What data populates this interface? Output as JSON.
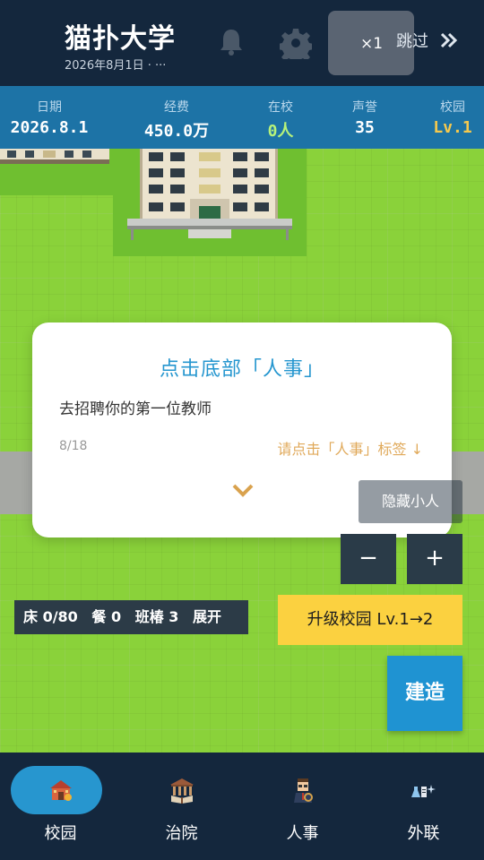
{
  "header": {
    "title": "猫扑大学",
    "subtitle": "2026年8月1日  ·  ···",
    "speed_label": "×1",
    "skip_label": "跳过"
  },
  "stats": [
    {
      "label": "日期",
      "value": "2026.8.1",
      "color": "#ffffff"
    },
    {
      "label": "经费",
      "value": "450.0万",
      "color": "#ffffff"
    },
    {
      "label": "在校",
      "value": "0人",
      "color": "#b7f27a"
    },
    {
      "label": "声誉",
      "value": "35",
      "color": "#ffffff"
    },
    {
      "label": "校园",
      "value": "Lv.1",
      "color": "#f6c94d"
    }
  ],
  "dialog": {
    "title": "点击底部「人事」",
    "text": "去招聘你的第一位教师",
    "progress": "8/18",
    "hint": "请点击「人事」标签 ↓"
  },
  "controls": {
    "ghost_label": "隐藏小人",
    "zoom_out": "−",
    "zoom_in": "+",
    "capacity": [
      "床 0/80",
      "餐 0",
      "班椿 3",
      "展开"
    ],
    "upgrade_label": "升级校园 Lv.1→2",
    "build_label": "建造"
  },
  "tabs": [
    {
      "label": "校园",
      "icon": "school-building-icon",
      "active": true
    },
    {
      "label": "治院",
      "icon": "library-icon",
      "active": false
    },
    {
      "label": "人事",
      "icon": "teacher-icon",
      "active": false
    },
    {
      "label": "外联",
      "icon": "lab-flask-icon",
      "active": false
    }
  ],
  "colors": {
    "header_bg": "#14273d",
    "stats_bg": "#1d73a6",
    "accent": "#2596cf",
    "upgrade_bg": "#fbd140",
    "grass": "#8ad23a"
  }
}
